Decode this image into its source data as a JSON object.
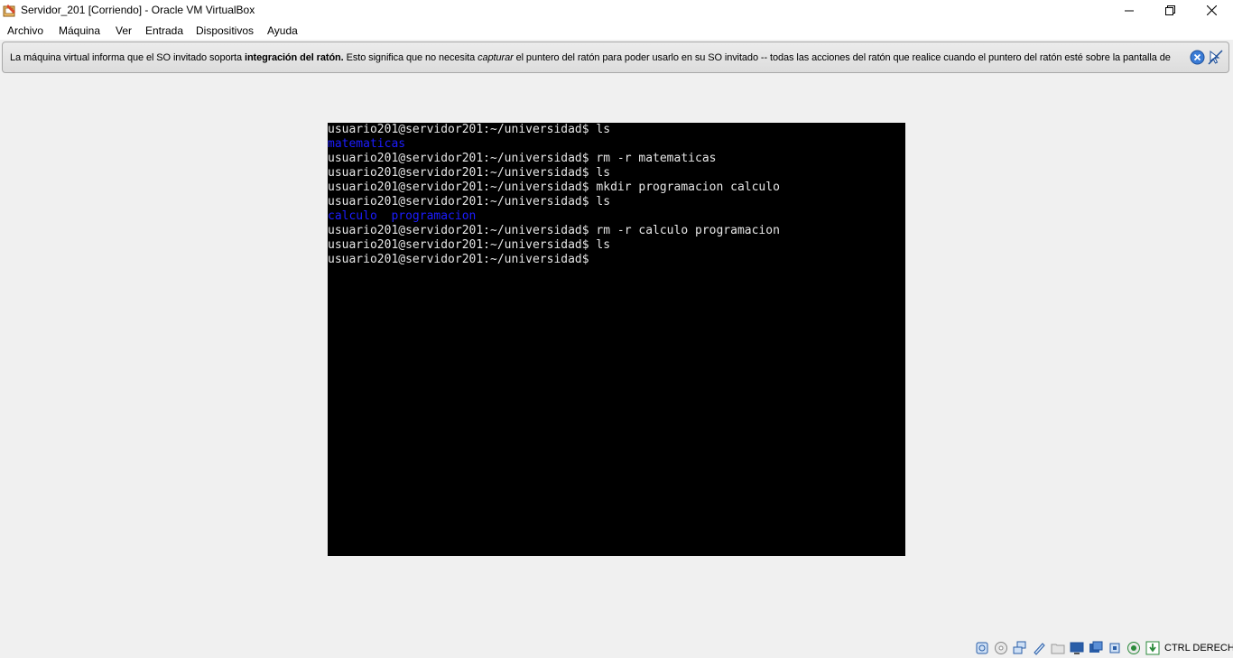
{
  "window": {
    "title": "Servidor_201 [Corriendo] - Oracle VM VirtualBox",
    "icon": "virtualbox-app-icon"
  },
  "menu": {
    "items": [
      "Archivo",
      "Máquina",
      "Ver",
      "Entrada",
      "Dispositivos",
      "Ayuda"
    ]
  },
  "notice": {
    "part1": "La máquina virtual informa que el SO invitado soporta ",
    "bold": "integración del ratón.",
    "part2": " Esto significa que no necesita ",
    "italic": "capturar",
    "part3": " el puntero del ratón para poder usarlo en su SO invitado -- todas las acciones del ratón que realice cuando el puntero del ratón esté sobre la pantalla de"
  },
  "terminal": {
    "lines": [
      {
        "text": "usuario201@servidor201:~/universidad$ ls",
        "kind": "cmd"
      },
      {
        "text": "matematicas",
        "kind": "dir"
      },
      {
        "text": "usuario201@servidor201:~/universidad$ rm -r matematicas",
        "kind": "cmd"
      },
      {
        "text": "usuario201@servidor201:~/universidad$ ls",
        "kind": "cmd"
      },
      {
        "text": "usuario201@servidor201:~/universidad$ mkdir programacion calculo",
        "kind": "cmd"
      },
      {
        "text": "usuario201@servidor201:~/universidad$ ls",
        "kind": "cmd"
      },
      {
        "text": "calculo  programacion",
        "kind": "dir"
      },
      {
        "text": "usuario201@servidor201:~/universidad$ rm -r calculo programacion",
        "kind": "cmd"
      },
      {
        "text": "usuario201@servidor201:~/universidad$ ls",
        "kind": "cmd"
      },
      {
        "text": "usuario201@servidor201:~/universidad$",
        "kind": "cmd"
      }
    ],
    "colors": {
      "background": "#000000",
      "text": "#e6e6e6",
      "directory": "#1c1cff"
    }
  },
  "statusbar": {
    "icons": [
      "hard-disk-icon",
      "optical-drive-icon",
      "network-icon",
      "usb-icon",
      "shared-folder-icon",
      "display-icon",
      "video-capture-icon",
      "cpu-icon",
      "recording-icon",
      "mouse-integration-icon",
      "keyboard-capture-icon"
    ],
    "host_key": "CTRL DERECHA"
  }
}
